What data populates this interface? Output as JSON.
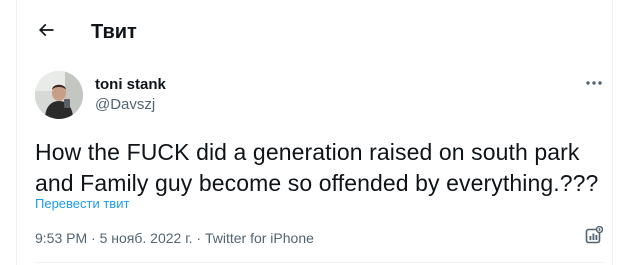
{
  "header": {
    "title": "Твит",
    "back_icon": "arrow-left-icon"
  },
  "tweet": {
    "author_name": "toni stank",
    "author_handle": "@Davszj",
    "text": "How the FUCK did a generation raised on south park and Family guy become so offended by everything.???",
    "translate_label": "Перевести твит",
    "time": "9:53 PM",
    "separator": " · ",
    "date": "5 нояб. 2022 г.",
    "source": "Twitter for iPhone",
    "more_icon": "more-horizontal-icon",
    "analytics_icon": "analytics-icon"
  },
  "colors": {
    "text_primary": "#0f1419",
    "text_secondary": "#536471",
    "link": "#1d9bf0",
    "divider": "#eff3f4"
  }
}
